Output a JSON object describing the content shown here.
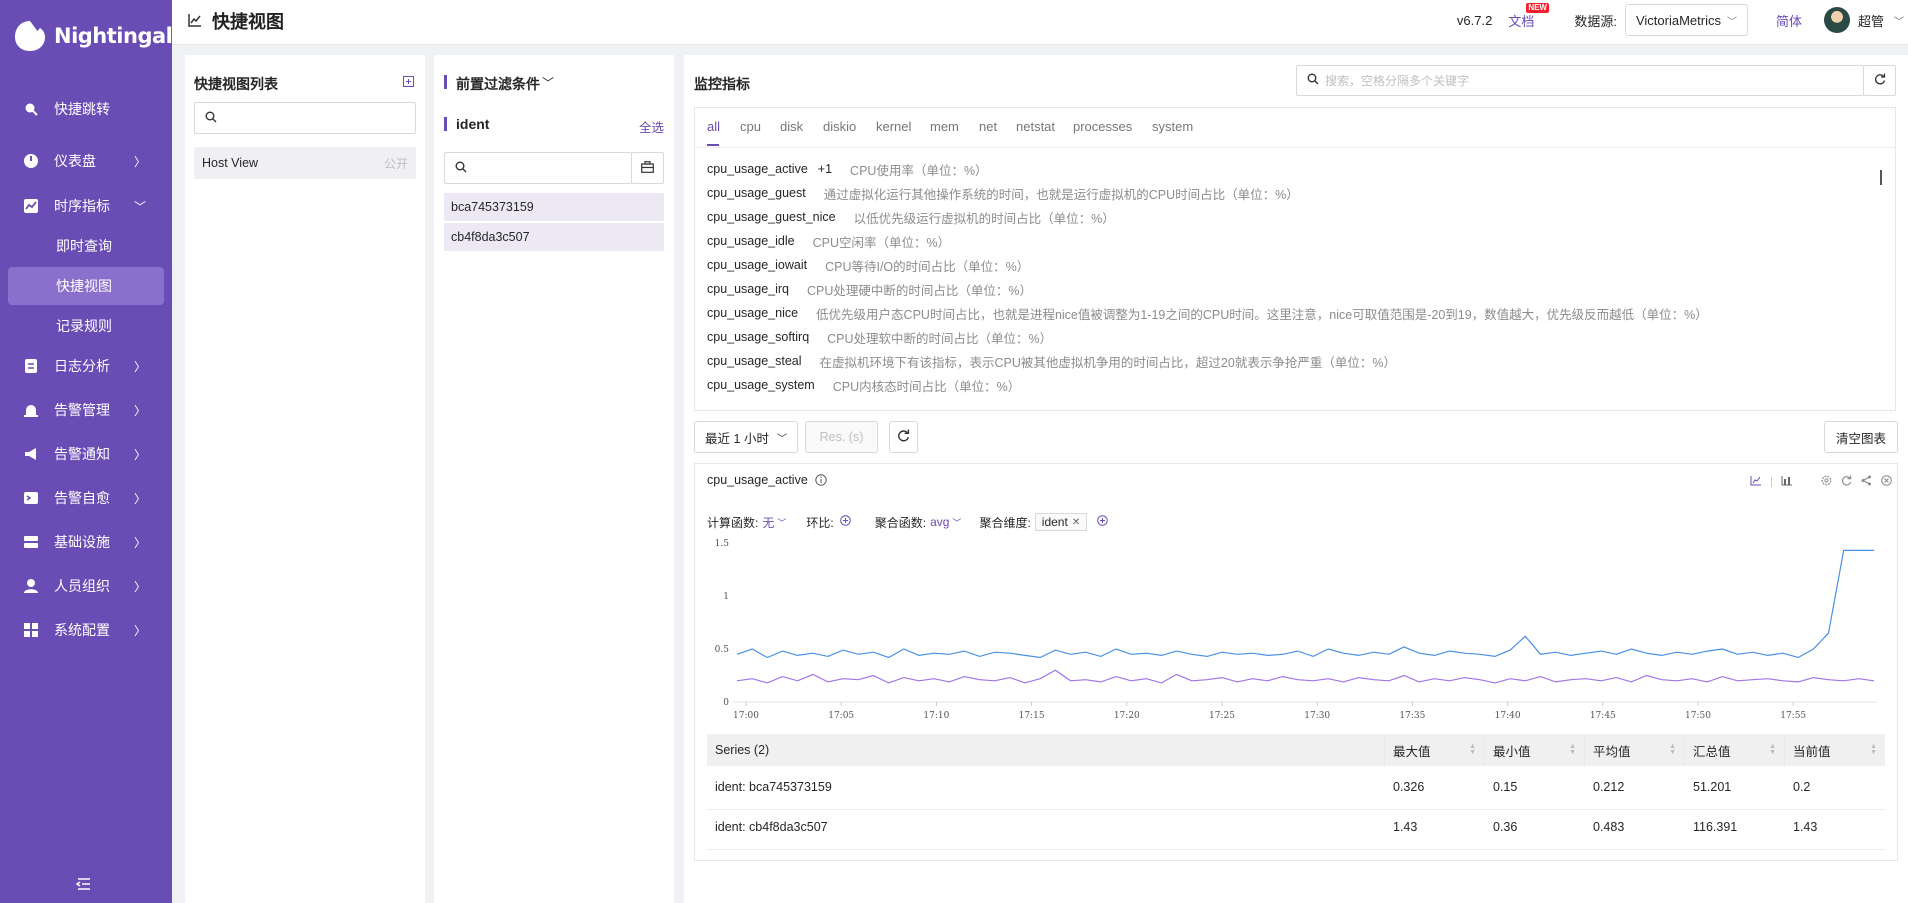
{
  "app": {
    "name": "Nightingale"
  },
  "sidebar": {
    "items": [
      {
        "label": "快捷跳转",
        "icon": "search-icon"
      },
      {
        "label": "仪表盘",
        "icon": "gauge-icon"
      },
      {
        "label": "时序指标",
        "icon": "line-chart-icon"
      },
      {
        "label": "日志分析",
        "icon": "document-icon"
      },
      {
        "label": "告警管理",
        "icon": "siren-icon"
      },
      {
        "label": "告警通知",
        "icon": "megaphone-icon"
      },
      {
        "label": "告警自愈",
        "icon": "terminal-icon"
      },
      {
        "label": "基础设施",
        "icon": "server-icon"
      },
      {
        "label": "人员组织",
        "icon": "user-icon"
      },
      {
        "label": "系统配置",
        "icon": "grid-icon"
      }
    ],
    "sub_items": [
      "即时查询",
      "快捷视图",
      "记录规则"
    ],
    "active_sub": "快捷视图"
  },
  "header": {
    "title": "快捷视图",
    "version": "v6.7.2",
    "docs": "文档",
    "docs_badge": "NEW",
    "datasource_label": "数据源:",
    "datasource_value": "VictoriaMetrics",
    "lang": "简体",
    "user": "超管"
  },
  "views_panel": {
    "title": "快捷视图列表",
    "items": [
      {
        "name": "Host View",
        "tag": "公开"
      }
    ]
  },
  "filter_panel": {
    "title": "前置过滤条件",
    "group_label": "ident",
    "select_all": "全选",
    "items": [
      "bca745373159",
      "cb4f8da3c507"
    ]
  },
  "metrics_panel": {
    "title": "监控指标",
    "search_placeholder": "搜索，空格分隔多个关键字",
    "tabs": [
      "all",
      "cpu",
      "disk",
      "diskio",
      "kernel",
      "mem",
      "net",
      "netstat",
      "processes",
      "system"
    ],
    "active_tab": "all",
    "metrics": [
      {
        "name": "cpu_usage_active",
        "extra": "+1",
        "desc": "CPU使用率（单位：%）"
      },
      {
        "name": "cpu_usage_guest",
        "desc": "通过虚拟化运行其他操作系统的时间，也就是运行虚拟机的CPU时间占比（单位：%）"
      },
      {
        "name": "cpu_usage_guest_nice",
        "desc": "以低优先级运行虚拟机的时间占比（单位：%）"
      },
      {
        "name": "cpu_usage_idle",
        "desc": "CPU空闲率（单位：%）"
      },
      {
        "name": "cpu_usage_iowait",
        "desc": "CPU等待I/O的时间占比（单位：%）"
      },
      {
        "name": "cpu_usage_irq",
        "desc": "CPU处理硬中断的时间占比（单位：%）"
      },
      {
        "name": "cpu_usage_nice",
        "desc": "低优先级用户态CPU时间占比，也就是进程nice值被调整为1-19之间的CPU时间。这里注意，nice可取值范围是-20到19，数值越大，优先级反而越低（单位：%）"
      },
      {
        "name": "cpu_usage_softirq",
        "desc": "CPU处理软中断的时间占比（单位：%）"
      },
      {
        "name": "cpu_usage_steal",
        "desc": "在虚拟机环境下有该指标，表示CPU被其他虚拟机争用的时间占比，超过20就表示争抢严重（单位：%）"
      },
      {
        "name": "cpu_usage_system",
        "desc": "CPU内核态时间占比（单位：%）"
      }
    ]
  },
  "toolbar": {
    "time_range": "最近 1 小时",
    "resolution_placeholder": "Res. (s)",
    "clear_button": "清空图表"
  },
  "chart_card": {
    "title": "cpu_usage_active",
    "calc_label": "计算函数:",
    "calc_value": "无",
    "ratio_label": "环比:",
    "agg_label": "聚合函数:",
    "agg_value": "avg",
    "dim_label": "聚合维度:",
    "dim_tag": "ident"
  },
  "chart_data": {
    "type": "line",
    "x_ticks": [
      "17:00",
      "17:05",
      "17:10",
      "17:15",
      "17:20",
      "17:25",
      "17:30",
      "17:35",
      "17:40",
      "17:45",
      "17:50",
      "17:55"
    ],
    "y_ticks": [
      "0",
      "0.5",
      "1",
      "1.5"
    ],
    "ylim": [
      0,
      1.5
    ],
    "series": [
      {
        "color": "#4a90e2",
        "values": [
          0.45,
          0.5,
          0.42,
          0.48,
          0.44,
          0.46,
          0.43,
          0.49,
          0.45,
          0.47,
          0.42,
          0.5,
          0.44,
          0.46,
          0.45,
          0.48,
          0.43,
          0.47,
          0.46,
          0.44,
          0.42,
          0.49,
          0.45,
          0.47,
          0.43,
          0.5,
          0.45,
          0.46,
          0.44,
          0.48,
          0.45,
          0.43,
          0.47,
          0.45,
          0.46,
          0.44,
          0.45,
          0.48,
          0.43,
          0.5,
          0.46,
          0.44,
          0.47,
          0.45,
          0.52,
          0.46,
          0.44,
          0.48,
          0.46,
          0.45,
          0.43,
          0.49,
          0.62,
          0.45,
          0.47,
          0.44,
          0.46,
          0.48,
          0.45,
          0.5,
          0.46,
          0.44,
          0.47,
          0.45,
          0.48,
          0.5,
          0.45,
          0.47,
          0.44,
          0.46,
          0.42,
          0.5,
          0.65,
          1.43,
          1.43,
          1.43
        ]
      },
      {
        "color": "#a274e8",
        "values": [
          0.2,
          0.22,
          0.18,
          0.24,
          0.2,
          0.26,
          0.19,
          0.22,
          0.21,
          0.25,
          0.18,
          0.23,
          0.2,
          0.22,
          0.19,
          0.24,
          0.21,
          0.2,
          0.23,
          0.18,
          0.22,
          0.3,
          0.2,
          0.21,
          0.19,
          0.24,
          0.2,
          0.22,
          0.18,
          0.26,
          0.2,
          0.21,
          0.23,
          0.19,
          0.22,
          0.2,
          0.24,
          0.21,
          0.2,
          0.22,
          0.19,
          0.23,
          0.21,
          0.2,
          0.25,
          0.19,
          0.22,
          0.2,
          0.23,
          0.21,
          0.18,
          0.22,
          0.2,
          0.24,
          0.19,
          0.21,
          0.22,
          0.2,
          0.23,
          0.19,
          0.25,
          0.21,
          0.2,
          0.22,
          0.19,
          0.24,
          0.2,
          0.21,
          0.22,
          0.2,
          0.19,
          0.23,
          0.21,
          0.2,
          0.22,
          0.2
        ]
      }
    ]
  },
  "table": {
    "headers": [
      "Series (2)",
      "最大值",
      "最小值",
      "平均值",
      "汇总值",
      "当前值"
    ],
    "rows": [
      [
        "ident: bca745373159",
        "0.326",
        "0.15",
        "0.212",
        "51.201",
        "0.2"
      ],
      [
        "ident: cb4f8da3c507",
        "1.43",
        "0.36",
        "0.483",
        "116.391",
        "1.43"
      ]
    ]
  }
}
